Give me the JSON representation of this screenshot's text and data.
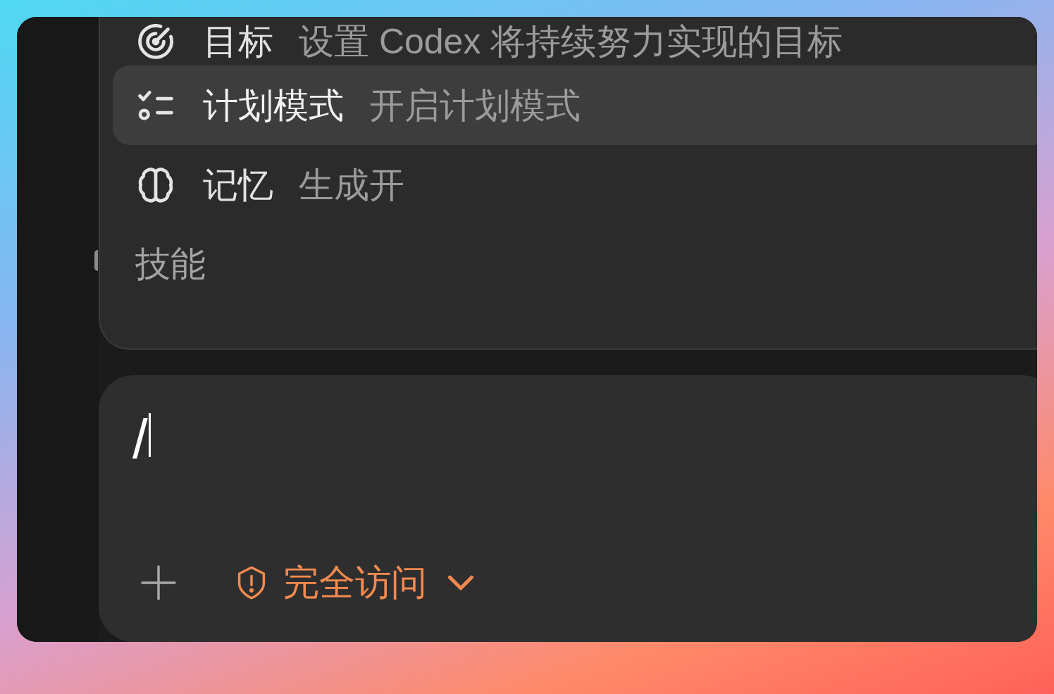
{
  "command_menu": {
    "items": [
      {
        "kind": "target",
        "label": "目标",
        "description": "设置 Codex 将持续努力实现的目标",
        "selected": false
      },
      {
        "kind": "plan",
        "label": "计划模式",
        "description": "开启计划模式",
        "selected": true
      },
      {
        "kind": "memory",
        "label": "记忆",
        "description": "生成开",
        "selected": false
      }
    ],
    "section_title": "技能"
  },
  "composer": {
    "value": "/",
    "access_mode": {
      "label": "完全访问"
    }
  }
}
